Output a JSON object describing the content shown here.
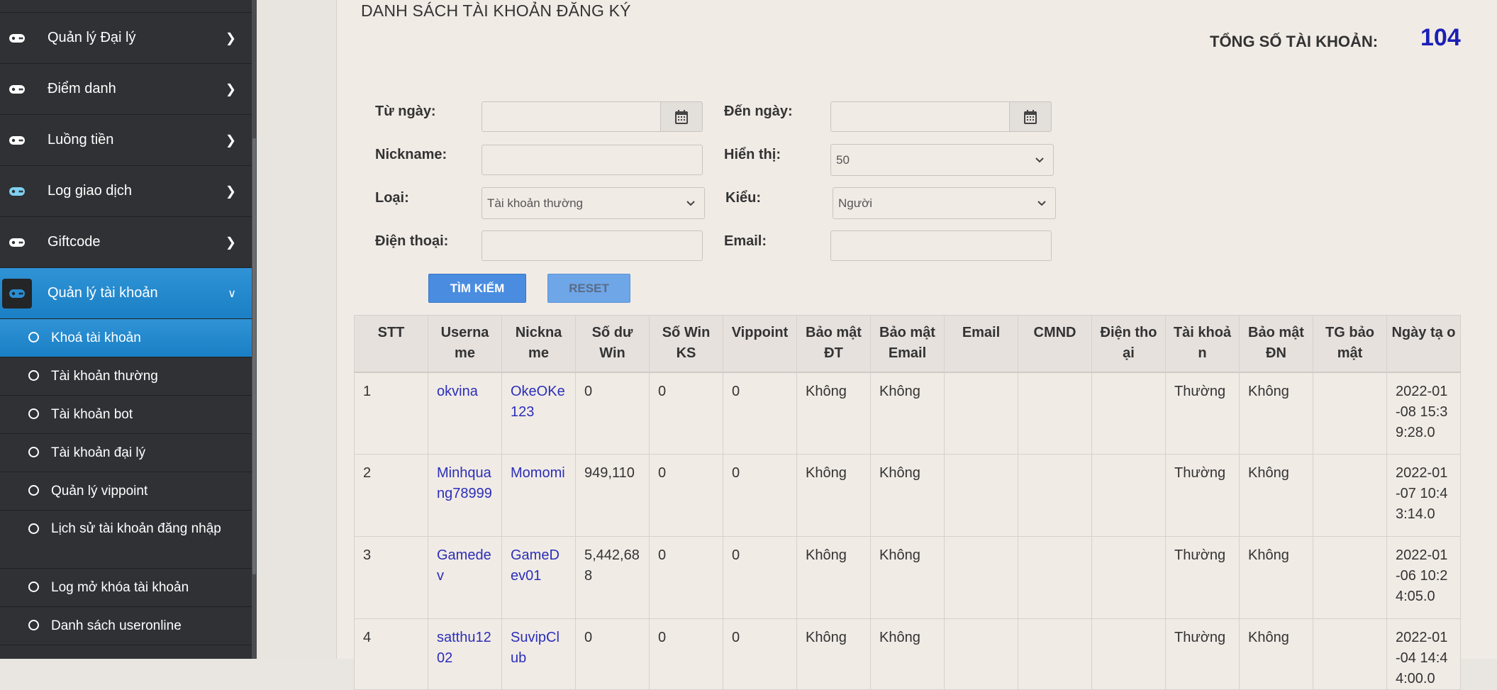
{
  "sidebar": {
    "menu": [
      {
        "label": "Quản lý Đại lý",
        "icon": "gamepad-icon",
        "active": false
      },
      {
        "label": "Điểm danh",
        "icon": "gamepad-icon",
        "active": false
      },
      {
        "label": "Luồng tiền",
        "icon": "gamepad-icon",
        "active": false
      },
      {
        "label": "Log giao dịch",
        "icon": "gamepad-icon",
        "active": false
      },
      {
        "label": "Giftcode",
        "icon": "gamepad-icon",
        "active": false
      },
      {
        "label": "Quản lý tài khoản",
        "icon": "gamepad-icon",
        "active": true
      }
    ],
    "submenu": [
      {
        "label": "Khoá tài khoản",
        "active": true
      },
      {
        "label": "Tài khoản thường",
        "active": false
      },
      {
        "label": "Tài khoản bot",
        "active": false
      },
      {
        "label": "Tài khoản đại lý",
        "active": false
      },
      {
        "label": "Quản lý vippoint",
        "active": false
      },
      {
        "label": "Lịch sử tài khoản đăng nhập",
        "active": false
      },
      {
        "label": "Log mở khóa tài khoản",
        "active": false
      },
      {
        "label": "Danh sách useronline",
        "active": false
      }
    ]
  },
  "page": {
    "title": "DANH SÁCH TÀI KHOẢN ĐĂNG KÝ",
    "total_label": "TỔNG SỐ TÀI KHOẢN:",
    "total_value": "104"
  },
  "filters": {
    "from_date_label": "Từ ngày:",
    "from_date_value": "",
    "to_date_label": "Đến ngày:",
    "to_date_value": "",
    "nickname_label": "Nickname:",
    "nickname_value": "",
    "display_label": "Hiển thị:",
    "display_value": "50",
    "type_label": "Loại:",
    "type_value": "Tài khoản thường",
    "kind_label": "Kiểu:",
    "kind_value": "Người",
    "phone_label": "Điện thoại:",
    "phone_value": "",
    "email_label": "Email:",
    "email_value": "",
    "search_button": "TÌM KIẾM",
    "reset_button": "RESET"
  },
  "table": {
    "headers": [
      "STT",
      "Userna me",
      "Nickna me",
      "Số dư Win",
      "Số Win KS",
      "Vippoint",
      "Bảo mật ĐT",
      "Bảo mật Email",
      "Email",
      "CMND",
      "Điện tho ại",
      "Tài khoả n",
      "Bảo mật ĐN",
      "TG bảo mật",
      "Ngày tạ o"
    ],
    "rows": [
      [
        "1",
        "okvina",
        "OkeOKe123",
        "0",
        "0",
        "0",
        "Không",
        "Không",
        "",
        "",
        "",
        "Thường",
        "Không",
        "",
        "2022-01-08 15:39:28.0"
      ],
      [
        "2",
        "Minhquang78999",
        "Momomi",
        "949,110",
        "0",
        "0",
        "Không",
        "Không",
        "",
        "",
        "",
        "Thường",
        "Không",
        "",
        "2022-01-07 10:43:14.0"
      ],
      [
        "3",
        "Gamedev",
        "GameDev01",
        "5,442,688",
        "0",
        "0",
        "Không",
        "Không",
        "",
        "",
        "",
        "Thường",
        "Không",
        "",
        "2022-01-06 10:24:05.0"
      ],
      [
        "4",
        "satthu1202",
        "SuvipClub",
        "0",
        "0",
        "0",
        "Không",
        "Không",
        "",
        "",
        "",
        "Thường",
        "Không",
        "",
        "2022-01-04 14:44:00.0"
      ]
    ]
  },
  "colors": {
    "sidebar_bg": "#2f3134",
    "active_blue": "#2a8dd2",
    "link": "#2b2fb8",
    "total_value": "#1a1fb5",
    "button_primary": "#4a8de0"
  }
}
